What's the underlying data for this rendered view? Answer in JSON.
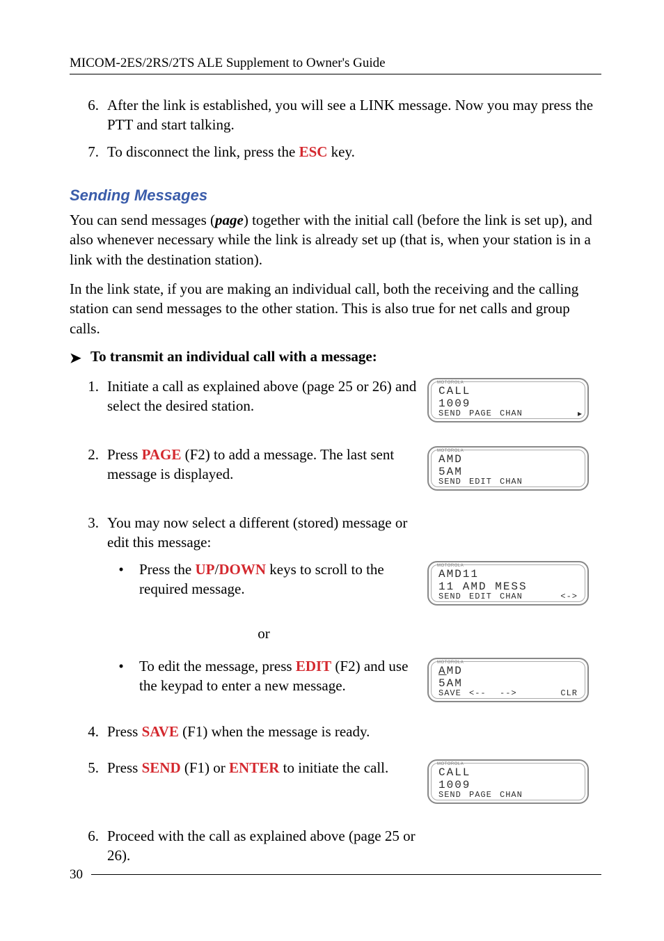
{
  "header": "MICOM-2ES/2RS/2TS ALE Supplement to Owner's Guide",
  "intro_list": [
    {
      "n": "6.",
      "before": "After the link is established, you will see a LINK message. Now you may press the PTT and start talking.",
      "key": "",
      "after": ""
    },
    {
      "n": "7.",
      "before": "To disconnect the link, press the ",
      "key": "ESC",
      "after": " key."
    }
  ],
  "section_title": "Sending Messages",
  "para1_before": "You can send messages (",
  "para1_bi": "page",
  "para1_after": ") together with the initial call (before the link is set up), and also whenever necessary while the link is already set up (that is, when your station is in a link with the destination station).",
  "para2": "In the link state, if you are making an individual call, both the receiving and the calling station can send messages to the other station. This is also true for net calls and group calls.",
  "to_line": "To transmit an individual call with a message:",
  "steps": {
    "s1": {
      "n": "1.",
      "txt": "Initiate a call as explained above (page 25 or 26) and select the desired station."
    },
    "s2": {
      "n": "2.",
      "before": "Press ",
      "key": "PAGE",
      "mid": " (F2) to add a message. The last sent message is displayed.",
      "after": ""
    },
    "s3": {
      "n": "3.",
      "txt": "You may now select a different (stored) message or edit this message:"
    },
    "b1": {
      "before": "Press the ",
      "key1": "UP",
      "sep": "/",
      "key2": "DOWN",
      "after": " keys to scroll to the required message."
    },
    "or": "or",
    "b2": {
      "before": "To edit the message, press ",
      "key": "EDIT",
      "after": " (F2) and use the keypad to enter a new message."
    },
    "s4": {
      "n": "4.",
      "before": "Press ",
      "key": "SAVE",
      "after": " (F1) when the message is ready."
    },
    "s5": {
      "n": "5.",
      "before": "Press ",
      "key1": "SEND",
      "mid": " (F1) or ",
      "key2": "ENTER",
      "after": " to initiate the call."
    },
    "s6": {
      "n": "6.",
      "txt": "Proceed with the call as explained above (page 25 or 26)."
    }
  },
  "lcd": {
    "moto": "MOTOROLA",
    "a": {
      "l1": "CALL",
      "l2": "1009",
      "sk1": "SEND",
      "sk2": "PAGE",
      "sk3": "CHAN",
      "arrow": "▸"
    },
    "b": {
      "l1": "AMD",
      "l2": "5AM",
      "sk1": "SEND",
      "sk2": "EDIT",
      "sk3": "CHAN"
    },
    "c": {
      "l1": "AMD11",
      "l2": "11 AMD MESS",
      "sk1": "SEND",
      "sk2": "EDIT",
      "sk3": "CHAN",
      "sk4": "<->"
    },
    "d": {
      "l1_pre": "A",
      "l1_post": "MD",
      "l2": "5AM",
      "sk1": "SAVE",
      "sk2": "<--",
      "sk3": "-->",
      "sk4": "CLR"
    },
    "e": {
      "l1": "CALL",
      "l2": "1009",
      "sk1": "SEND",
      "sk2": "PAGE",
      "sk3": "CHAN"
    }
  },
  "page_number": "30"
}
